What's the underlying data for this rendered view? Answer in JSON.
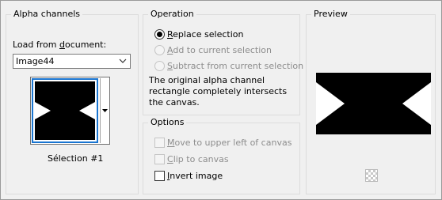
{
  "alpha_channels": {
    "title": "Alpha channels",
    "load_from_label_pre": "Load from ",
    "load_from_label_mnemonic": "d",
    "load_from_label_post": "ocument:",
    "document_value": "Image44",
    "selection_name": "Sélection #1"
  },
  "operation": {
    "title": "Operation",
    "options": [
      {
        "mnemonic": "R",
        "rest": "eplace selection",
        "selected": true,
        "enabled": true
      },
      {
        "mnemonic": "A",
        "rest": "dd to current selection",
        "selected": false,
        "enabled": false
      },
      {
        "mnemonic": "S",
        "rest": "ubtract from current selection",
        "selected": false,
        "enabled": false
      }
    ],
    "description": "The original alpha channel rectangle completely intersects the canvas."
  },
  "options": {
    "title": "Options",
    "items": [
      {
        "mnemonic": "M",
        "rest": "ove to upper left of canvas",
        "checked": false,
        "enabled": false
      },
      {
        "mnemonic": "C",
        "rest": "lip to canvas",
        "checked": false,
        "enabled": false
      },
      {
        "mnemonic": "I",
        "rest": "nvert image",
        "checked": false,
        "enabled": true
      }
    ]
  },
  "preview": {
    "title": "Preview"
  },
  "colors": {
    "selection_border": "#1874d0",
    "mask_black": "#000000",
    "mask_white": "#ffffff"
  },
  "icons": {
    "select_arrow": "chevron-down-icon",
    "thumb_dropdown": "triangle-down-icon",
    "transparency": "checkerboard-icon"
  }
}
